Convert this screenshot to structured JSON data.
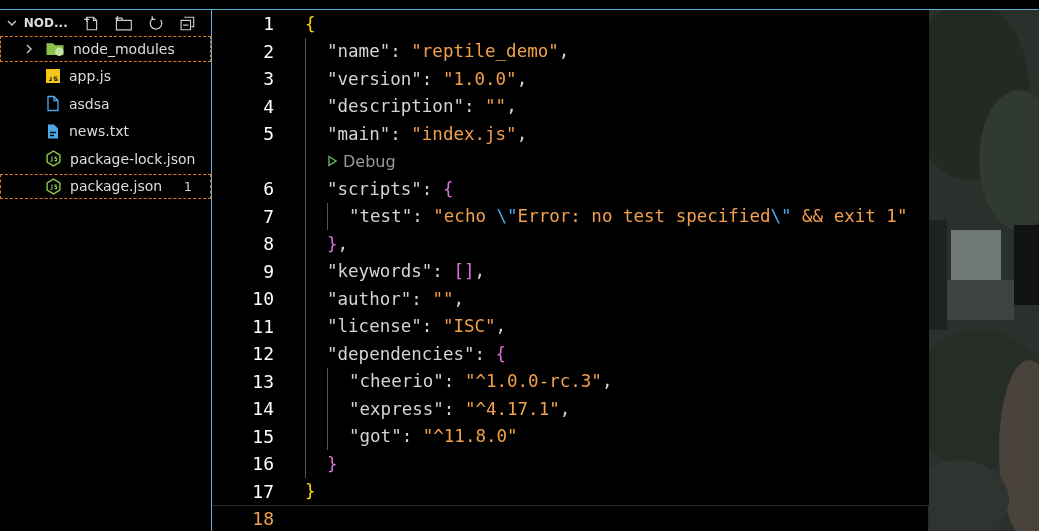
{
  "explorer": {
    "title": "NOD...",
    "expanded": true,
    "items": [
      {
        "name": "node_modules",
        "kind": "folder",
        "expanded": false,
        "outlined": true
      },
      {
        "name": "app.js",
        "kind": "js",
        "outlined": false
      },
      {
        "name": "asdsa",
        "kind": "file",
        "outlined": false
      },
      {
        "name": "news.txt",
        "kind": "text",
        "outlined": false
      },
      {
        "name": "package-lock.json",
        "kind": "node",
        "outlined": false
      },
      {
        "name": "package.json",
        "kind": "node",
        "outlined": true,
        "badge": "1"
      }
    ]
  },
  "editor": {
    "lines": [
      {
        "number": "1",
        "selected": false,
        "tokens": [
          {
            "text": "{",
            "kind": "brace1"
          }
        ],
        "children": [
          {
            "number": "2",
            "selected": false,
            "tokens": [
              {
                "text": "\"name\"",
                "kind": "key"
              },
              {
                "text": ": ",
                "kind": "punct"
              },
              {
                "text": "\"reptile_demo\"",
                "kind": "string"
              },
              {
                "text": ",",
                "kind": "punct"
              }
            ]
          },
          {
            "number": "3",
            "selected": false,
            "tokens": [
              {
                "text": "\"version\"",
                "kind": "key"
              },
              {
                "text": ": ",
                "kind": "punct"
              },
              {
                "text": "\"1.0.0\"",
                "kind": "string"
              },
              {
                "text": ",",
                "kind": "punct"
              }
            ]
          },
          {
            "number": "4",
            "selected": false,
            "tokens": [
              {
                "text": "\"description\"",
                "kind": "key"
              },
              {
                "text": ": ",
                "kind": "punct"
              },
              {
                "text": "\"\"",
                "kind": "string"
              },
              {
                "text": ",",
                "kind": "punct"
              }
            ]
          },
          {
            "number": "5",
            "selected": false,
            "tokens": [
              {
                "text": "\"main\"",
                "kind": "key"
              },
              {
                "text": ": ",
                "kind": "punct"
              },
              {
                "text": "\"index.js\"",
                "kind": "string"
              },
              {
                "text": ",",
                "kind": "punct"
              }
            ]
          },
          {
            "kind": "codelens",
            "label": "Debug"
          },
          {
            "number": "6",
            "selected": false,
            "tokens": [
              {
                "text": "\"scripts\"",
                "kind": "key"
              },
              {
                "text": ": ",
                "kind": "punct"
              },
              {
                "text": "{",
                "kind": "brace2"
              }
            ],
            "children": [
              {
                "number": "7",
                "selected": false,
                "tokens": [
                  {
                    "text": "\"test\"",
                    "kind": "key"
                  },
                  {
                    "text": ": ",
                    "kind": "punct"
                  },
                  {
                    "text": "\"echo ",
                    "kind": "string"
                  },
                  {
                    "text": "\\\"",
                    "kind": "escape"
                  },
                  {
                    "text": "Error: no test specified",
                    "kind": "string"
                  },
                  {
                    "text": "\\\"",
                    "kind": "escape"
                  },
                  {
                    "text": " && exit 1\"",
                    "kind": "string"
                  }
                ]
              }
            ]
          },
          {
            "number": "8",
            "selected": false,
            "tokens": [
              {
                "text": "}",
                "kind": "brace2"
              },
              {
                "text": ",",
                "kind": "punct"
              }
            ]
          },
          {
            "number": "9",
            "selected": false,
            "tokens": [
              {
                "text": "\"keywords\"",
                "kind": "key"
              },
              {
                "text": ": ",
                "kind": "punct"
              },
              {
                "text": "[]",
                "kind": "brace2"
              },
              {
                "text": ",",
                "kind": "punct"
              }
            ]
          },
          {
            "number": "10",
            "selected": false,
            "tokens": [
              {
                "text": "\"author\"",
                "kind": "key"
              },
              {
                "text": ": ",
                "kind": "punct"
              },
              {
                "text": "\"\"",
                "kind": "string"
              },
              {
                "text": ",",
                "kind": "punct"
              }
            ]
          },
          {
            "number": "11",
            "selected": false,
            "tokens": [
              {
                "text": "\"license\"",
                "kind": "key"
              },
              {
                "text": ": ",
                "kind": "punct"
              },
              {
                "text": "\"ISC\"",
                "kind": "string"
              },
              {
                "text": ",",
                "kind": "punct"
              }
            ]
          },
          {
            "number": "12",
            "selected": false,
            "tokens": [
              {
                "text": "\"dependencies\"",
                "kind": "key"
              },
              {
                "text": ": ",
                "kind": "punct"
              },
              {
                "text": "{",
                "kind": "brace2"
              }
            ],
            "children": [
              {
                "number": "13",
                "selected": false,
                "tokens": [
                  {
                    "text": "\"cheerio\"",
                    "kind": "key"
                  },
                  {
                    "text": ": ",
                    "kind": "punct"
                  },
                  {
                    "text": "\"^1.0.0-rc.3\"",
                    "kind": "string"
                  },
                  {
                    "text": ",",
                    "kind": "punct"
                  }
                ]
              },
              {
                "number": "14",
                "selected": false,
                "tokens": [
                  {
                    "text": "\"express\"",
                    "kind": "key"
                  },
                  {
                    "text": ": ",
                    "kind": "punct"
                  },
                  {
                    "text": "\"^4.17.1\"",
                    "kind": "string"
                  },
                  {
                    "text": ",",
                    "kind": "punct"
                  }
                ]
              },
              {
                "number": "15",
                "selected": false,
                "tokens": [
                  {
                    "text": "\"got\"",
                    "kind": "key"
                  },
                  {
                    "text": ": ",
                    "kind": "punct"
                  },
                  {
                    "text": "\"^11.8.0\"",
                    "kind": "string"
                  }
                ]
              }
            ]
          },
          {
            "number": "16",
            "selected": false,
            "tokens": [
              {
                "text": "}",
                "kind": "brace2"
              }
            ]
          }
        ]
      },
      {
        "number": "17",
        "selected": false,
        "tokens": [
          {
            "text": "}",
            "kind": "brace1"
          }
        ]
      },
      {
        "number": "18",
        "selected": true
      }
    ]
  }
}
